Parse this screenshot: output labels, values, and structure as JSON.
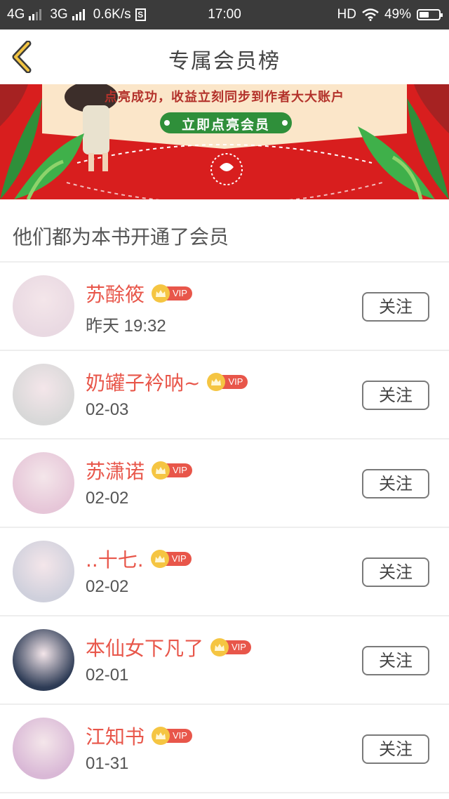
{
  "status_bar": {
    "net1": "4G",
    "net2": "3G",
    "speed": "0.6K/s",
    "s_badge": "S",
    "time": "17:00",
    "hd": "HD",
    "battery": "49%",
    "battery_level": 0.49
  },
  "header": {
    "title": "专属会员榜",
    "back_icon": "chevron-left-icon"
  },
  "banner": {
    "headline": "点亮成功，收益立刻同步到作者大大账户",
    "button_label": "立即点亮会员",
    "colors": {
      "red": "#d81e1e",
      "cream": "#fbe6c9",
      "green": "#2f8f3a"
    }
  },
  "section_title": "他们都为本书开通了会员",
  "members": [
    {
      "name": "苏酴筱",
      "vip": "VIP",
      "time": "昨天 19:32",
      "follow": "关注",
      "avatar_color": "#e9d9e2"
    },
    {
      "name": "奶罐子衿呐~",
      "vip": "VIP",
      "time": "02-03",
      "follow": "关注",
      "avatar_color": "#d8d8d8"
    },
    {
      "name": "苏潇诺",
      "vip": "VIP",
      "time": "02-02",
      "follow": "关注",
      "avatar_color": "#e6c6d8"
    },
    {
      "name": "..十七.",
      "vip": "VIP",
      "time": "02-02",
      "follow": "关注",
      "avatar_color": "#cfd0dc"
    },
    {
      "name": "本仙女下凡了",
      "vip": "VIP",
      "time": "02-01",
      "follow": "关注",
      "avatar_color": "#2d3b55"
    },
    {
      "name": "江知书",
      "vip": "VIP",
      "time": "01-31",
      "follow": "关注",
      "avatar_color": "#d9b8d6"
    }
  ],
  "colors": {
    "accent": "#e8564a",
    "vip_gold": "#f5c542"
  }
}
